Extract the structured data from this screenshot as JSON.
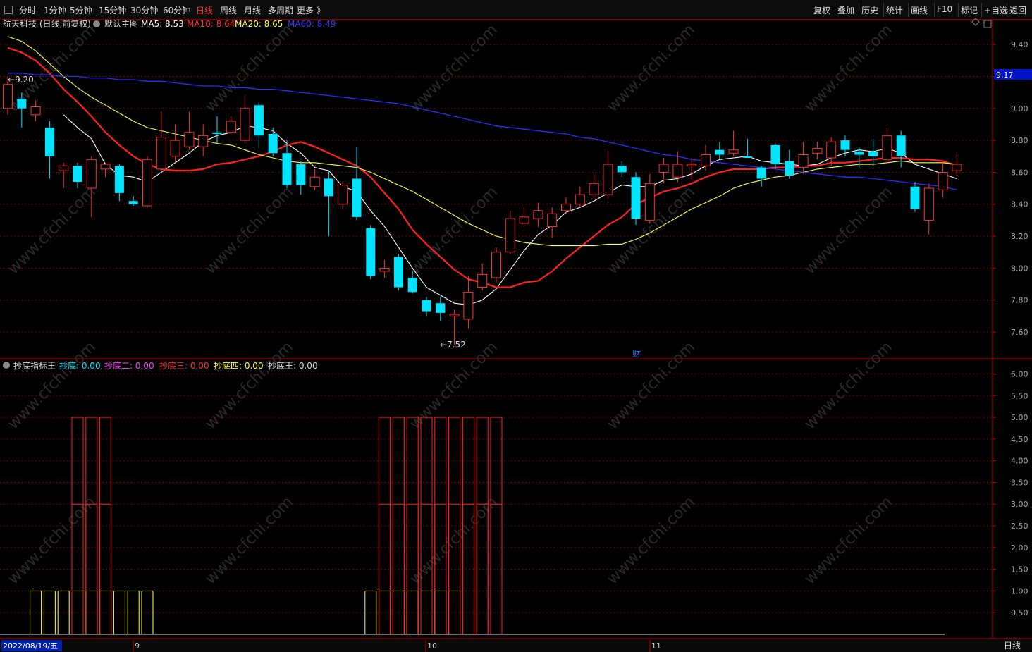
{
  "toolbar": {
    "periods": [
      "分时",
      "1分钟",
      "5分钟",
      "15分钟",
      "30分钟",
      "60分钟",
      "日线",
      "周线",
      "月线",
      "多周期",
      "更多 》"
    ],
    "active_period": "日线",
    "right_buttons": [
      "复权",
      "叠加",
      "历史",
      "统计",
      "画线",
      "F10",
      "标记",
      "+自选",
      "返回"
    ]
  },
  "main_info": {
    "stock": "航天科技 (日线,前复权)",
    "template": "默认主图",
    "ma5": "MA5: 8.53",
    "ma10": "MA10: 8.64",
    "ma20": "MA20: 8.65",
    "ma60": "MA60: 8.49"
  },
  "sub_info": {
    "name": "抄底指标王",
    "v1": "抄底: 0.00",
    "v2": "抄底二: 0.00",
    "v3": "抄底三: 0.00",
    "v4": "抄底四: 0.00",
    "v5": "抄底王: 0.00"
  },
  "current_price": "9.17",
  "bottom": {
    "date": "2022/08/19/五",
    "months": [
      "9",
      "10",
      "11"
    ],
    "period_label": "日线"
  },
  "colors": {
    "up": "#ff3232",
    "down": "#00e4ff",
    "ma5": "#ffffff",
    "ma10": "#ff2020",
    "ma20": "#ffff40",
    "ma60": "#2b2bff",
    "grid": "#8b0000",
    "axis": "#c00000"
  },
  "chart_data": [
    {
      "type": "candlestick",
      "title": "航天科技 (日线,前复权)",
      "y_ticks": [
        "9.40",
        "9.20",
        "9.00",
        "8.80",
        "8.60",
        "8.40",
        "8.20",
        "8.00",
        "7.80",
        "7.60"
      ],
      "ylim": [
        7.45,
        9.48
      ],
      "annotations": {
        "high": "9.20",
        "low": "7.52",
        "marker": "财"
      },
      "candles": [
        [
          9.0,
          9.15,
          9.2,
          8.96
        ],
        [
          9.06,
          9.0,
          9.1,
          8.88
        ],
        [
          8.96,
          9.01,
          9.05,
          8.92
        ],
        [
          8.88,
          8.7,
          8.92,
          8.56
        ],
        [
          8.61,
          8.64,
          8.66,
          8.5
        ],
        [
          8.64,
          8.54,
          8.66,
          8.5
        ],
        [
          8.5,
          8.68,
          8.7,
          8.32
        ],
        [
          8.62,
          8.65,
          8.66,
          8.57
        ],
        [
          8.64,
          8.47,
          8.65,
          8.42
        ],
        [
          8.42,
          8.4,
          8.45,
          8.39
        ],
        [
          8.39,
          8.68,
          8.7,
          8.38
        ],
        [
          8.62,
          8.82,
          8.98,
          8.61
        ],
        [
          8.7,
          8.8,
          8.9,
          8.66
        ],
        [
          8.76,
          8.85,
          8.98,
          8.74
        ],
        [
          8.76,
          8.83,
          8.9,
          8.7
        ],
        [
          8.85,
          8.84,
          8.95,
          8.78
        ],
        [
          8.85,
          8.92,
          8.95,
          8.84
        ],
        [
          8.8,
          9.0,
          9.08,
          8.78
        ],
        [
          9.02,
          8.83,
          9.04,
          8.75
        ],
        [
          8.84,
          8.72,
          8.88,
          8.7
        ],
        [
          8.72,
          8.52,
          8.8,
          8.5
        ],
        [
          8.65,
          8.52,
          8.67,
          8.46
        ],
        [
          8.51,
          8.57,
          8.62,
          8.49
        ],
        [
          8.56,
          8.45,
          8.61,
          8.2
        ],
        [
          8.4,
          8.52,
          8.54,
          8.37
        ],
        [
          8.56,
          8.32,
          8.76,
          8.3
        ],
        [
          8.25,
          7.95,
          8.27,
          7.93
        ],
        [
          7.98,
          8.0,
          8.05,
          7.94
        ],
        [
          8.07,
          7.88,
          8.09,
          7.86
        ],
        [
          7.94,
          7.85,
          7.98,
          7.84
        ],
        [
          7.8,
          7.73,
          7.82,
          7.7
        ],
        [
          7.78,
          7.72,
          7.82,
          7.67
        ],
        [
          7.7,
          7.71,
          7.74,
          7.52
        ],
        [
          7.68,
          7.85,
          7.95,
          7.62
        ],
        [
          7.88,
          7.96,
          8.03,
          7.86
        ],
        [
          7.94,
          8.1,
          8.13,
          7.91
        ],
        [
          8.1,
          8.31,
          8.36,
          8.09
        ],
        [
          8.28,
          8.32,
          8.38,
          8.26
        ],
        [
          8.31,
          8.36,
          8.41,
          8.26
        ],
        [
          8.26,
          8.34,
          8.38,
          8.19
        ],
        [
          8.36,
          8.4,
          8.44,
          8.34
        ],
        [
          8.4,
          8.46,
          8.51,
          8.38
        ],
        [
          8.46,
          8.53,
          8.6,
          8.43
        ],
        [
          8.46,
          8.65,
          8.73,
          8.43
        ],
        [
          8.64,
          8.6,
          8.67,
          8.57
        ],
        [
          8.57,
          8.31,
          8.6,
          8.27
        ],
        [
          8.3,
          8.53,
          8.59,
          8.28
        ],
        [
          8.6,
          8.65,
          8.69,
          8.53
        ],
        [
          8.57,
          8.65,
          8.73,
          8.54
        ],
        [
          8.64,
          8.65,
          8.69,
          8.55
        ],
        [
          8.64,
          8.71,
          8.77,
          8.61
        ],
        [
          8.74,
          8.71,
          8.79,
          8.68
        ],
        [
          8.72,
          8.74,
          8.86,
          8.7
        ],
        [
          8.7,
          8.69,
          8.81,
          8.69
        ],
        [
          8.63,
          8.56,
          8.64,
          8.51
        ],
        [
          8.77,
          8.65,
          8.78,
          8.62
        ],
        [
          8.67,
          8.58,
          8.74,
          8.56
        ],
        [
          8.63,
          8.71,
          8.79,
          8.59
        ],
        [
          8.72,
          8.75,
          8.79,
          8.68
        ],
        [
          8.69,
          8.79,
          8.82,
          8.64
        ],
        [
          8.8,
          8.74,
          8.83,
          8.7
        ],
        [
          8.73,
          8.71,
          8.76,
          8.63
        ],
        [
          8.73,
          8.7,
          8.81,
          8.64
        ],
        [
          8.68,
          8.83,
          8.88,
          8.66
        ],
        [
          8.83,
          8.7,
          8.86,
          8.63
        ],
        [
          8.51,
          8.37,
          8.54,
          8.35
        ],
        [
          8.3,
          8.5,
          8.53,
          8.21
        ],
        [
          8.49,
          8.6,
          8.66,
          8.44
        ],
        [
          8.61,
          8.65,
          8.71,
          8.58
        ]
      ],
      "series": [
        {
          "name": "MA5",
          "values": [
            null,
            null,
            null,
            null,
            8.96,
            8.88,
            8.81,
            8.65,
            8.58,
            8.57,
            8.54,
            8.6,
            8.66,
            8.72,
            8.79,
            8.83,
            8.85,
            8.89,
            8.88,
            8.86,
            8.78,
            8.72,
            8.63,
            8.61,
            8.51,
            8.48,
            8.36,
            8.26,
            8.13,
            8.0,
            7.88,
            7.83,
            7.78,
            7.77,
            7.8,
            7.87,
            7.99,
            8.11,
            8.21,
            8.27,
            8.35,
            8.38,
            8.42,
            8.47,
            8.52,
            8.51,
            8.51,
            8.55,
            8.56,
            8.59,
            8.64,
            8.68,
            8.69,
            8.7,
            8.67,
            8.66,
            8.65,
            8.64,
            8.65,
            8.69,
            8.72,
            8.74,
            8.73,
            8.75,
            8.72,
            8.65,
            8.62,
            8.59,
            8.56
          ]
        },
        {
          "name": "MA10",
          "values": [
            9.38,
            9.35,
            9.3,
            9.22,
            9.12,
            9.04,
            8.95,
            8.85,
            8.77,
            8.7,
            8.65,
            8.62,
            8.61,
            8.61,
            8.62,
            8.65,
            8.66,
            8.68,
            8.7,
            8.73,
            8.77,
            8.79,
            8.76,
            8.72,
            8.68,
            8.64,
            8.57,
            8.47,
            8.37,
            8.24,
            8.15,
            8.07,
            7.99,
            7.93,
            7.91,
            7.88,
            7.88,
            7.91,
            7.92,
            7.98,
            8.06,
            8.13,
            8.2,
            8.27,
            8.32,
            8.4,
            8.44,
            8.48,
            8.5,
            8.53,
            8.57,
            8.6,
            8.62,
            8.62,
            8.62,
            8.63,
            8.63,
            8.64,
            8.64,
            8.66,
            8.66,
            8.67,
            8.68,
            8.69,
            8.69,
            8.68,
            8.68,
            8.67,
            8.64
          ]
        },
        {
          "name": "MA20",
          "values": [
            9.45,
            9.42,
            9.36,
            9.28,
            9.2,
            9.13,
            9.07,
            9.02,
            8.97,
            8.92,
            8.88,
            8.86,
            8.84,
            8.82,
            8.8,
            8.78,
            8.77,
            8.74,
            8.71,
            8.69,
            8.67,
            8.66,
            8.66,
            8.65,
            8.64,
            8.63,
            8.6,
            8.56,
            8.52,
            8.48,
            8.43,
            8.38,
            8.33,
            8.28,
            8.24,
            8.2,
            8.18,
            8.16,
            8.15,
            8.14,
            8.14,
            8.14,
            8.14,
            8.15,
            8.15,
            8.18,
            8.22,
            8.27,
            8.32,
            8.37,
            8.41,
            8.45,
            8.5,
            8.53,
            8.55,
            8.57,
            8.58,
            8.6,
            8.62,
            8.63,
            8.64,
            8.65,
            8.65,
            8.66,
            8.67,
            8.66,
            8.66,
            8.66,
            8.65
          ]
        },
        {
          "name": "MA60",
          "values": [
            9.22,
            9.22,
            9.21,
            9.21,
            9.2,
            9.2,
            9.19,
            9.19,
            9.18,
            9.18,
            9.17,
            9.17,
            9.16,
            9.15,
            9.14,
            9.14,
            9.13,
            9.13,
            9.12,
            9.12,
            9.11,
            9.1,
            9.09,
            9.08,
            9.07,
            9.06,
            9.05,
            9.04,
            9.03,
            9.01,
            8.99,
            8.97,
            8.95,
            8.93,
            8.91,
            8.89,
            8.88,
            8.87,
            8.86,
            8.85,
            8.84,
            8.82,
            8.81,
            8.79,
            8.77,
            8.75,
            8.73,
            8.71,
            8.7,
            8.68,
            8.67,
            8.66,
            8.65,
            8.64,
            8.63,
            8.62,
            8.61,
            8.6,
            8.59,
            8.58,
            8.57,
            8.57,
            8.56,
            8.55,
            8.54,
            8.53,
            8.52,
            8.51,
            8.49
          ]
        }
      ]
    },
    {
      "type": "bar",
      "title": "抄底指标王",
      "y_ticks": [
        "6.00",
        "5.50",
        "5.00",
        "4.50",
        "4.00",
        "3.50",
        "3.00",
        "2.50",
        "2.00",
        "1.50",
        "1.00",
        "0.50"
      ],
      "ylim": [
        0,
        6.3
      ],
      "series": [
        {
          "name": "抄底王",
          "values": [
            0,
            0,
            0,
            0,
            0,
            5,
            5,
            5,
            0,
            0,
            0,
            0,
            0,
            0,
            0,
            0,
            0,
            0,
            0,
            0,
            0,
            0,
            0,
            0,
            0,
            0,
            0,
            5,
            5,
            5,
            5,
            5,
            5,
            5,
            5,
            5,
            0,
            0,
            0,
            0,
            0,
            0,
            0,
            0,
            0,
            0,
            0,
            0,
            0,
            0,
            0,
            0,
            0,
            0,
            0,
            0,
            0,
            0,
            0,
            0,
            0,
            0,
            0,
            0,
            0,
            0,
            0,
            0,
            0
          ]
        },
        {
          "name": "抄底四",
          "values": [
            0,
            0,
            1,
            1,
            1,
            1,
            1,
            1,
            1,
            1,
            1,
            0,
            0,
            0,
            0,
            0,
            0,
            0,
            0,
            0,
            0,
            0,
            0,
            0,
            0,
            0,
            1,
            1,
            1,
            1,
            1,
            1,
            1,
            0,
            0,
            0,
            0,
            0,
            0,
            0,
            0,
            0,
            0,
            0,
            0,
            0,
            0,
            0,
            0,
            0,
            0,
            0,
            0,
            0,
            0,
            0,
            0,
            0,
            0,
            0,
            0,
            0,
            0,
            0,
            0,
            0,
            0,
            0,
            0
          ]
        },
        {
          "name": "抄底二",
          "values": [
            0,
            0,
            0,
            0,
            0,
            3,
            3,
            3,
            0,
            0,
            0,
            0,
            0,
            0,
            0,
            0,
            0,
            0,
            0,
            0,
            0,
            0,
            0,
            0,
            0,
            0,
            0,
            3,
            3,
            3,
            3,
            3,
            3,
            3,
            3,
            3,
            0,
            0,
            0,
            0,
            0,
            0,
            0,
            0,
            0,
            0,
            0,
            0,
            0,
            0,
            0,
            0,
            0,
            0,
            0,
            0,
            0,
            0,
            0,
            0,
            0,
            0,
            0,
            0,
            0,
            0,
            0,
            0,
            0
          ]
        }
      ]
    }
  ]
}
